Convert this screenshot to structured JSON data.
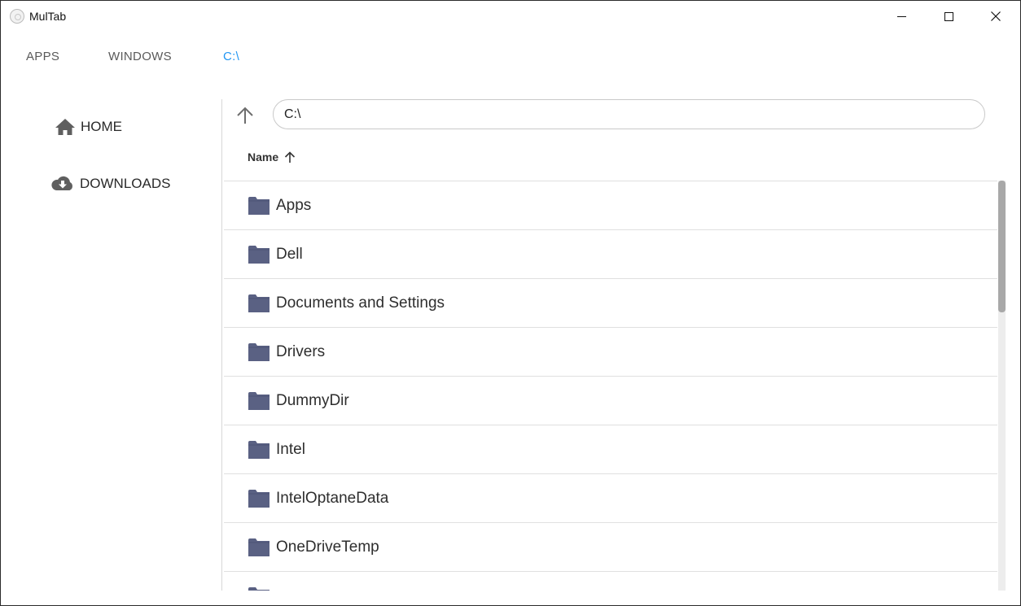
{
  "window": {
    "title": "MulTab",
    "controls": {
      "minimize": "minimize-icon",
      "maximize": "maximize-icon",
      "close": "close-icon"
    }
  },
  "tabs": [
    {
      "label": "APPS",
      "active": false
    },
    {
      "label": "WINDOWS",
      "active": false
    },
    {
      "label": "C:\\",
      "active": true
    }
  ],
  "accent_color": "#2196f3",
  "folder_color": "#5a6183",
  "sidebar": {
    "items": [
      {
        "label": "HOME",
        "icon": "home-icon"
      },
      {
        "label": "DOWNLOADS",
        "icon": "cloud-download-icon"
      }
    ]
  },
  "main": {
    "path_value": "C:\\",
    "up_icon": "arrow-up-icon",
    "column_header": {
      "label": "Name",
      "sort": "ascending",
      "icon": "sort-arrow-up-icon"
    },
    "rows": [
      {
        "name": "Apps",
        "icon": "folder-icon"
      },
      {
        "name": "Dell",
        "icon": "folder-icon"
      },
      {
        "name": "Documents and Settings",
        "icon": "folder-icon"
      },
      {
        "name": "Drivers",
        "icon": "folder-icon"
      },
      {
        "name": "DummyDir",
        "icon": "folder-icon"
      },
      {
        "name": "Intel",
        "icon": "folder-icon"
      },
      {
        "name": "IntelOptaneData",
        "icon": "folder-icon"
      },
      {
        "name": "OneDriveTemp",
        "icon": "folder-icon"
      },
      {
        "name": "",
        "icon": "folder-icon"
      }
    ]
  }
}
